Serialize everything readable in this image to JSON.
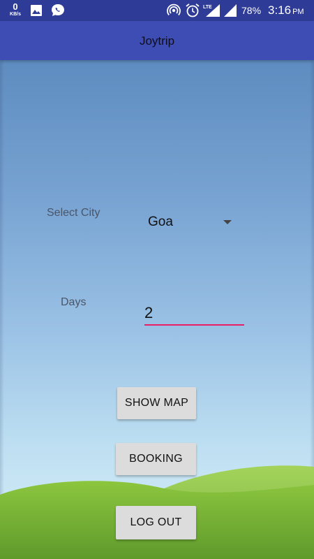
{
  "status_bar": {
    "net_speed_value": "0",
    "net_speed_unit": "KB/s",
    "battery_percent": "78%",
    "time": "3:16",
    "time_period": "PM",
    "lte_label": "LTE",
    "icons": [
      "image-icon",
      "whatsapp-icon",
      "hotspot-icon",
      "alarm-icon",
      "lte-signal-icon",
      "signal-icon",
      "battery-icon"
    ]
  },
  "app_bar": {
    "title": "Joytrip"
  },
  "form": {
    "city_label": "Select City",
    "city_selected": "Goa",
    "days_label": "Days",
    "days_value": "2"
  },
  "buttons": {
    "show_map": "SHOW MAP",
    "booking": "BOOKING",
    "log_out": "LOG OUT"
  },
  "colors": {
    "status_bar": "#2f3c97",
    "app_bar": "#3d4db3",
    "accent_underline": "#e91e63",
    "sky_top": "#5e8cc0",
    "sky_bottom": "#d8eef8",
    "hill_green": "#7cb342",
    "button_bg": "#dcdcdc"
  }
}
